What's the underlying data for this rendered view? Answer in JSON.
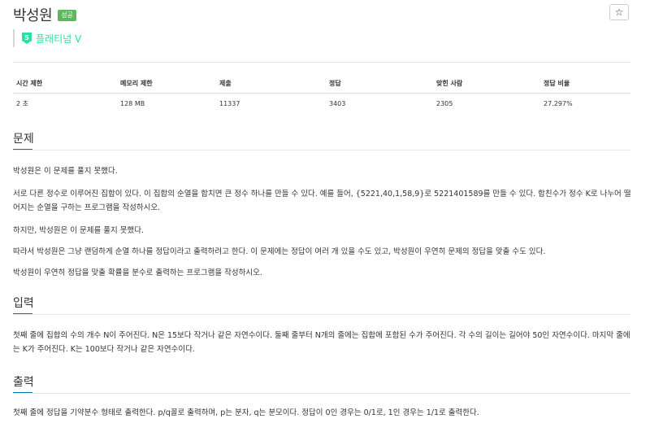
{
  "header": {
    "title": "박성원",
    "badge": "성공",
    "star_icon": "star-icon"
  },
  "tier": {
    "icon": "tier-icon",
    "icon_text": "5",
    "label": "플래티넘 V",
    "color": "#27e2a4"
  },
  "info_table": {
    "headers": [
      "시간 제한",
      "메모리 제한",
      "제출",
      "정답",
      "맞힌 사람",
      "정답 비율"
    ],
    "values": [
      "2 초",
      "128 MB",
      "11337",
      "3403",
      "2305",
      "27.297%"
    ]
  },
  "problem": {
    "heading": "문제",
    "paragraphs": [
      "박성원은 이 문제를 풀지 못했다.",
      "서로 다른 정수로 이루어진 집합이 있다. 이 집합의 순열을 합치면 큰 정수 하나를 만들 수 있다. 예를 들어, {5221,40,1,58,9}로 5221401589를 만들 수 있다. 합친수가 정수 K로 나누어 떨어지는 순열을 구하는 프로그램을 작성하시오.",
      "하지만, 박성원은 이 문제를 풀지 못했다.",
      "따라서 박성원은 그냥 랜덤하게 순열 하나를 정답이라고 출력하려고 한다. 이 문제에는 정답이 여러 개 있을 수도 있고, 박성원이 우연히 문제의 정답을 맞출 수도 있다.",
      "박성원이 우연히 정답을 맞출 확률을 분수로 출력하는 프로그램을 작성하시오."
    ]
  },
  "input_section": {
    "heading": "입력",
    "text": "첫째 줄에 집합의 수의 개수 N이 주어진다. N은 15보다 작거나 같은 자연수이다. 둘째 줄부터 N개의 줄에는 집합에 포함된 수가 주어진다. 각 수의 길이는 길어야 50인 자연수이다. 마지막 줄에는 K가 주어진다. K는 100보다 작거나 같은 자연수이다."
  },
  "output_section": {
    "heading": "출력",
    "text": "첫째 줄에 정답을 기약분수 형태로 출력한다. p/q꼴로 출력하며, p는 분자, q는 분모이다. 정답이 0인 경우는 0/1로, 1인 경우는 1/1로 출력한다."
  },
  "colors": {
    "badge": "#5cb85c",
    "section_accent": "#0076c0",
    "tier": "#27e2a4"
  }
}
